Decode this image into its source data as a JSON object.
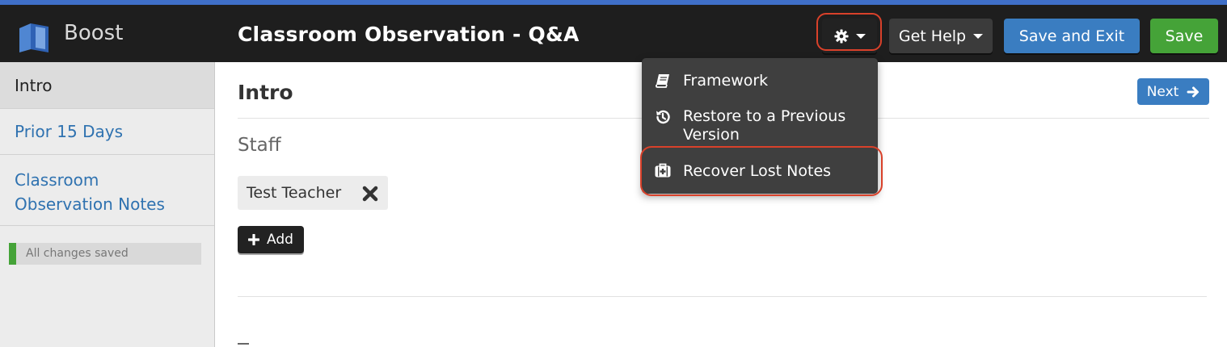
{
  "app": {
    "brand": "Boost",
    "title": "Classroom Observation - Q&A"
  },
  "toolbar": {
    "get_help_label": "Get Help",
    "save_exit_label": "Save and Exit",
    "save_label": "Save"
  },
  "settings_menu": {
    "items": [
      {
        "label": "Framework",
        "icon": "book-icon"
      },
      {
        "label": "Restore to a Previous Version",
        "icon": "history-icon"
      },
      {
        "label": "Recover Lost Notes",
        "icon": "medkit-icon"
      }
    ]
  },
  "sidebar": {
    "items": [
      {
        "label": "Intro",
        "active": true
      },
      {
        "label": "Prior 15 Days",
        "active": false
      },
      {
        "label": "Classroom Observation Notes",
        "active": false
      }
    ],
    "status": "All changes saved"
  },
  "main": {
    "title": "Intro",
    "next_label": "Next",
    "section_label": "Staff",
    "staff": [
      "Test Teacher"
    ],
    "add_label": "Add"
  },
  "colors": {
    "accent_blue": "#3a7dc1",
    "save_green": "#45a338",
    "topbar": "#1e1e1e",
    "highlight_red": "#d9412a"
  }
}
